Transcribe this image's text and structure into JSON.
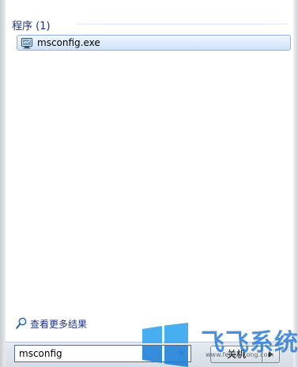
{
  "results": {
    "group_title": "程序 (1)",
    "items": [
      {
        "label": "msconfig.exe",
        "icon": "msconfig-app-icon"
      }
    ]
  },
  "more_results": {
    "label": "查看更多结果",
    "icon": "search-icon"
  },
  "search": {
    "value": "msconfig",
    "clear_glyph": "✕"
  },
  "shutdown": {
    "label": "关机"
  },
  "watermark": {
    "brand_text": "飞飞系统",
    "url_text": "www.feifeixitong.com",
    "colors": {
      "tile_light": "#33a5ee",
      "tile_dark": "#1e7fd6"
    }
  },
  "colors": {
    "header_text": "#1e3287",
    "selection_border": "#8fb3dd",
    "selection_fill": "#dcebfc"
  }
}
